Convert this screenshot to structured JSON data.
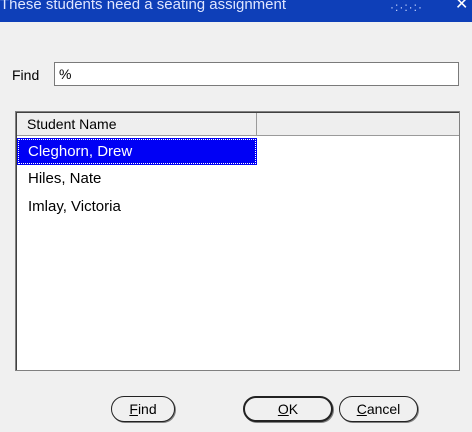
{
  "window": {
    "title": "These students need a seating assignment",
    "grip": "·:·:·:·",
    "close_glyph": "✕"
  },
  "find": {
    "label": "Find",
    "value": "%"
  },
  "list": {
    "column_header": "Student Name",
    "rows": [
      "Cleghorn, Drew",
      "Hiles, Nate",
      "Imlay, Victoria"
    ],
    "selected_index": 0
  },
  "buttons": {
    "find": {
      "mnemonic": "F",
      "rest": "ind"
    },
    "ok": {
      "mnemonic": "O",
      "rest": "K"
    },
    "cancel": {
      "mnemonic": "C",
      "rest": "ancel"
    }
  },
  "colors": {
    "titlebar": "#0e3fb8",
    "selection": "#0000f5",
    "background": "#f0f0f0"
  }
}
